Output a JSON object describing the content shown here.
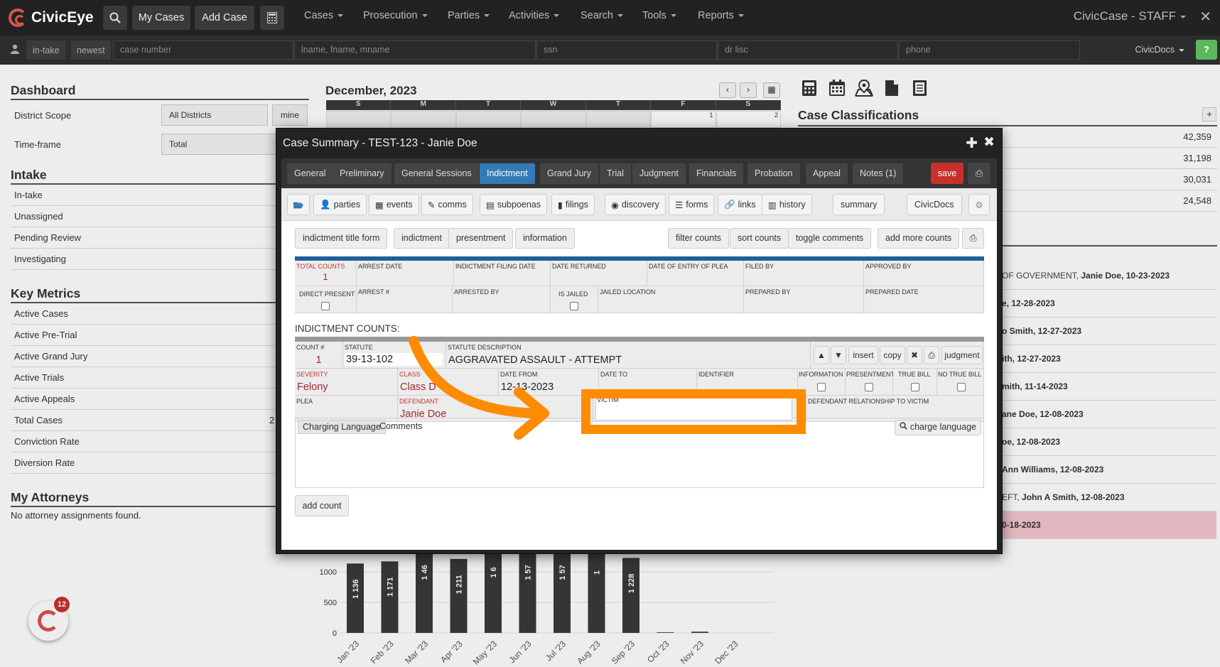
{
  "nav": {
    "brand": "CivicEye",
    "my_cases": "My Cases",
    "add_case": "Add Case",
    "menus": [
      "Cases",
      "Prosecution",
      "Parties",
      "Activities",
      "Search",
      "Tools",
      "Reports"
    ],
    "tenant": "CivicCase - STAFF",
    "close": "✕"
  },
  "searchbar": {
    "intake": "in-take",
    "newest": "newest",
    "case_number": "case number",
    "name": "lname, fname, mname",
    "ssn": "ssn",
    "dr_lisc": "dr lisc",
    "phone": "phone",
    "civicdocs": "CivicDocs",
    "help": "?"
  },
  "dashboard": {
    "title": "Dashboard",
    "district_label": "District Scope",
    "district_value": "All Districts",
    "mine": "mine",
    "timeframe_label": "Time-frame",
    "timeframe_value": "Total",
    "intake_title": "Intake",
    "intake_items": [
      "In-take",
      "Unassigned",
      "Pending Review",
      "Investigating"
    ],
    "metrics_title": "Key Metrics",
    "metrics_items": [
      "Active Cases",
      "Active Pre-Trial",
      "Active Grand Jury",
      "Active Trials",
      "Active Appeals",
      "Total Cases",
      "Conviction Rate",
      "Diversion Rate"
    ],
    "total_cases_partial": "2",
    "attorneys_title": "My Attorneys",
    "attorneys_empty": "No attorney assignments found."
  },
  "calendar": {
    "title": "December, 2023",
    "days": [
      "S",
      "M",
      "T",
      "W",
      "T",
      "F",
      "S"
    ],
    "first_row": [
      "",
      "",
      "",
      "",
      "",
      "1",
      "2"
    ]
  },
  "classifications": {
    "title": "Case Classifications",
    "plus": "+",
    "values": [
      "42,359",
      "31,198",
      "30,031",
      "24,548"
    ]
  },
  "activity": [
    {
      "pre": "OF GOVERNMENT, ",
      "bold": "Janie Doe, 10-23-2023"
    },
    {
      "pre": "",
      "bold": "e, 12-28-2023"
    },
    {
      "pre": "",
      "bold": "o Smith, 12-27-2023"
    },
    {
      "pre": "",
      "bold": "ith, 12-27-2023"
    },
    {
      "pre": "",
      "bold": "mith, 11-14-2023"
    },
    {
      "pre": "",
      "bold": "ane Doe, 12-08-2023"
    },
    {
      "pre": "",
      "bold": "oe, 12-08-2023"
    },
    {
      "pre": "",
      "bold": "Ann Williams, 12-08-2023"
    },
    {
      "pre": "EFT, ",
      "bold": "John A Smith, 12-08-2023"
    },
    {
      "pre": "",
      "bold": "0-18-2023"
    }
  ],
  "chart_data": {
    "type": "bar",
    "categories": [
      "Jan '23",
      "Feb '23",
      "Mar '23",
      "Apr '23",
      "May '23",
      "Jun '23",
      "Jul '23",
      "Aug '23",
      "Sep '23",
      "Oct '23",
      "Nov '23",
      "Dec '23"
    ],
    "values": [
      1136,
      1171,
      1463,
      1211,
      1600,
      1570,
      1570,
      1500,
      1228,
      10,
      20,
      0
    ],
    "value_labels": [
      "1 136",
      "1 171",
      "1 46",
      "1 211",
      "1 6",
      "1 57",
      "1 57",
      "1",
      "1 228",
      "",
      "",
      ""
    ],
    "yticks": [
      0,
      500,
      1000
    ],
    "ylim": [
      0,
      2200
    ]
  },
  "modal": {
    "title": "Case Summary - TEST-123 - Janie Doe",
    "tabs": [
      "General",
      "Preliminary",
      "General Sessions",
      "Indictment",
      "Grand Jury",
      "Trial",
      "Judgment",
      "Financials",
      "Probation",
      "Appeal",
      "Notes (1)"
    ],
    "save": "save",
    "sub_toolbar": [
      "parties",
      "events",
      "comms",
      "subpoenas",
      "filings",
      "discovery",
      "forms",
      "links",
      "history"
    ],
    "summary": "summary",
    "civicdocs": "CivicDocs",
    "actions_left": [
      "indictment title form",
      "indictment",
      "presentment",
      "information"
    ],
    "actions_right": [
      "filter counts",
      "sort counts",
      "toggle comments",
      "add more counts"
    ],
    "header_fields": {
      "total_counts_label": "TOTAL COUNTS",
      "total_counts_value": "1",
      "arrest_date": "ARREST DATE",
      "indictment_filing_date": "INDICTMENT FILING DATE",
      "date_returned": "DATE RETURNED",
      "date_of_entry_of_plea": "DATE OF ENTRY OF PLEA",
      "filed_by": "FILED BY",
      "approved_by": "APPROVED BY",
      "direct_present": "DIRECT PRESENT",
      "arrest_num": "ARREST #",
      "arrested_by": "ARRESTED BY",
      "is_jailed": "IS JAILED",
      "jailed_location": "JAILED LOCATION",
      "prepared_by": "PREPARED BY",
      "prepared_date": "PREPARED DATE"
    },
    "counts_heading": "INDICTMENT COUNTS:",
    "count": {
      "count_num_label": "COUNT #",
      "count_num": "1",
      "statute_label": "STATUTE",
      "statute": "39-13-102",
      "desc_label": "STATUTE DESCRIPTION",
      "desc": "AGGRAVATED ASSAULT - ATTEMPT",
      "insert": "insert",
      "copy": "copy",
      "judgment": "judgment",
      "severity_label": "SEVERITY",
      "severity": "Felony",
      "class_label": "CLASS",
      "class": "Class D",
      "date_from_label": "DATE FROM",
      "date_from": "12-13-2023",
      "date_to_label": "DATE TO",
      "identifier_label": "IDENTIFIER",
      "information_label": "INFORMATION",
      "presentment_label": "PRESENTMENT",
      "true_bill_label": "TRUE BILL",
      "no_true_bill_label": "NO TRUE BILL",
      "plea_label": "PLEA",
      "defendant_label": "DEFENDANT",
      "defendant": "Janie Doe",
      "victim_label": "VICTIM",
      "relationship_label": "DEFENDANT RELATIONSHIP TO VICTIM"
    },
    "charging_language": "Charging Language",
    "comments": "Comments",
    "charge_language_btn": "charge language",
    "add_count": "add count"
  },
  "fab_badge": "12",
  "colors": {
    "accent": "#337ab7",
    "danger": "#c9302c",
    "highlight": "#ff8c00"
  }
}
